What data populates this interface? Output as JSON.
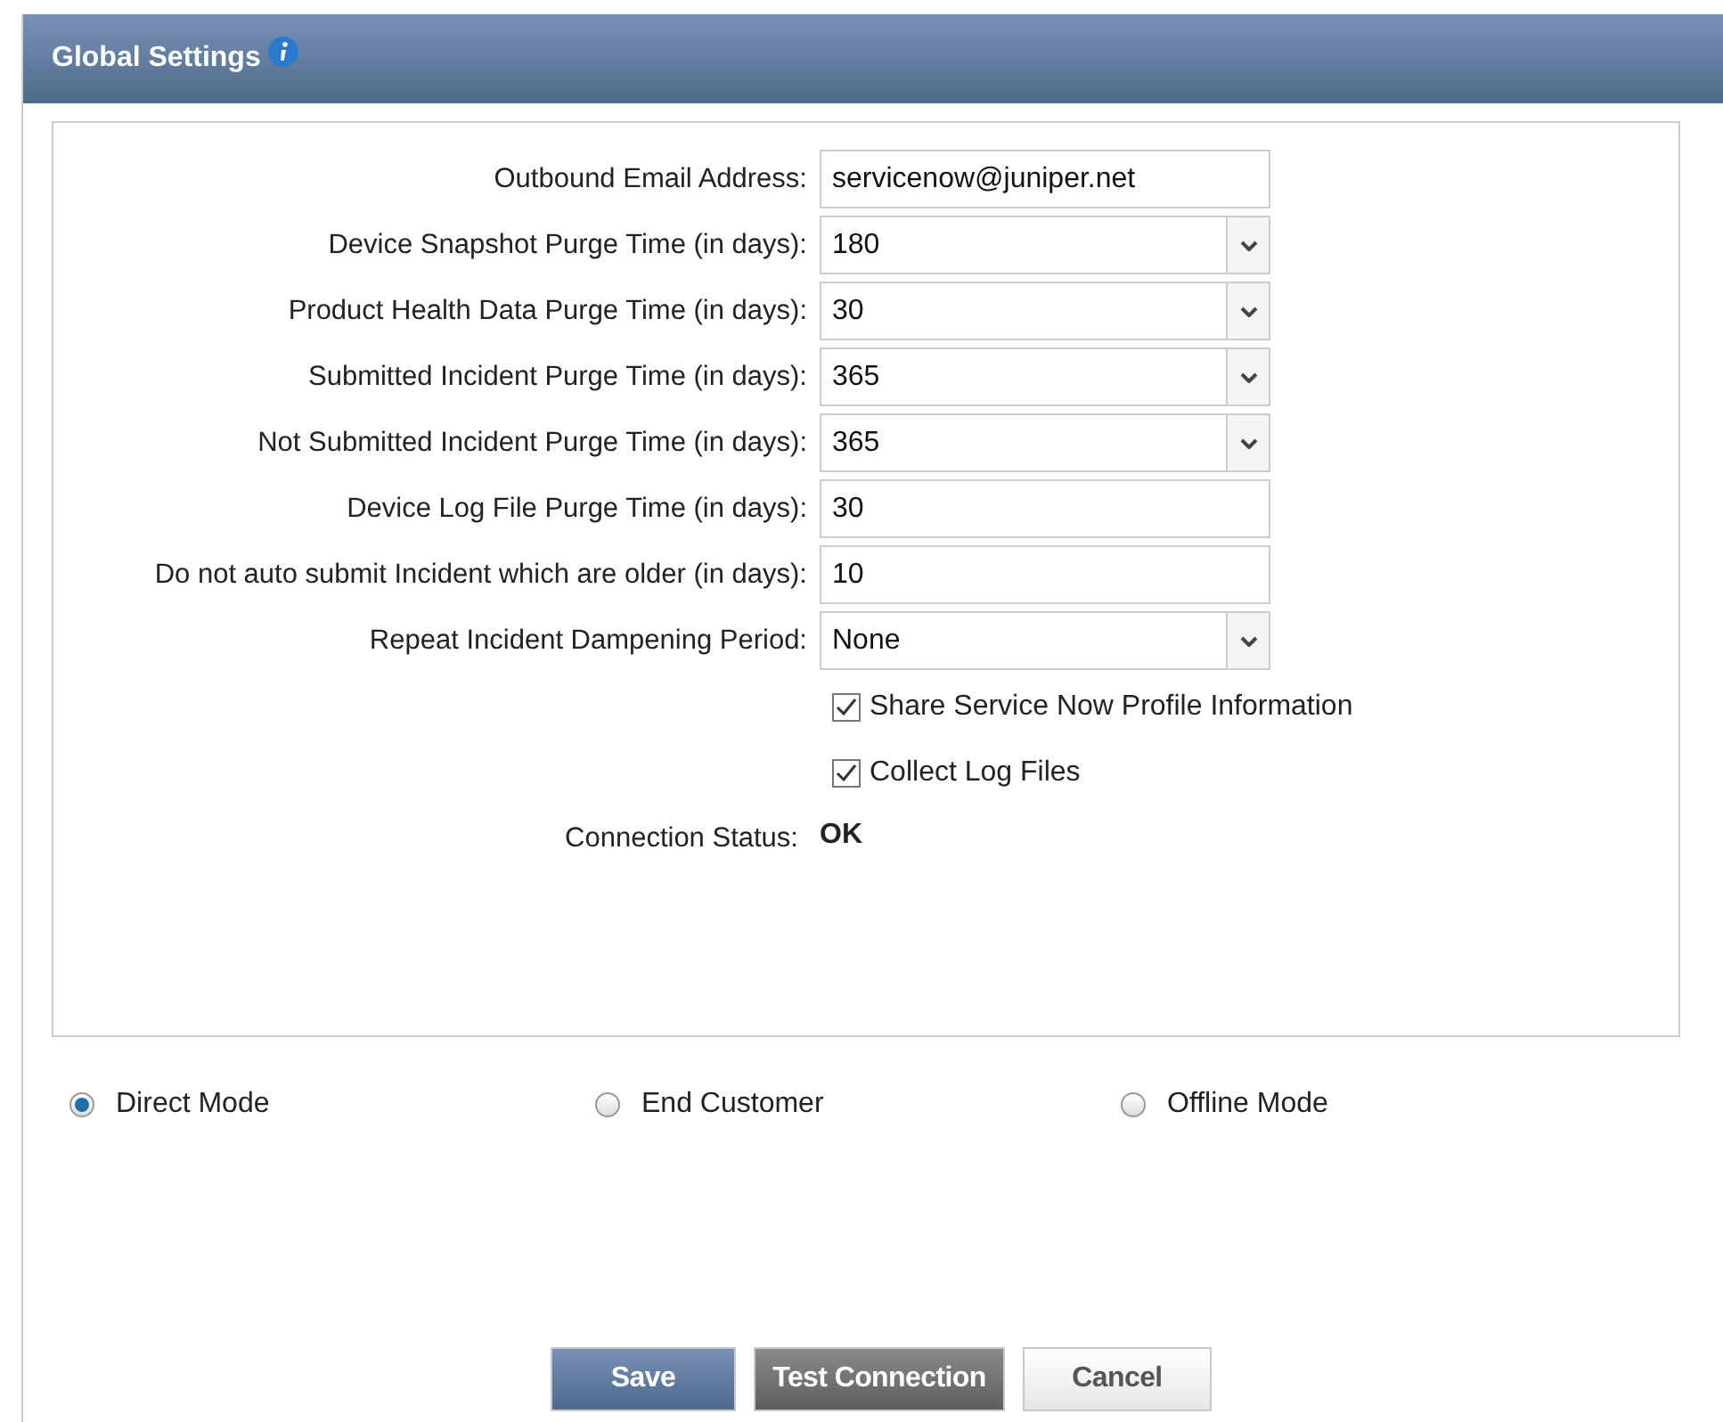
{
  "panel": {
    "title": "Global Settings"
  },
  "fields": [
    {
      "label": "Outbound Email Address:",
      "kind": "text",
      "value": "servicenow@juniper.net"
    },
    {
      "label": "Device Snapshot Purge Time (in days):",
      "kind": "select",
      "value": "180"
    },
    {
      "label": "Product Health Data Purge Time (in days):",
      "kind": "select",
      "value": "30"
    },
    {
      "label": "Submitted Incident Purge Time (in days):",
      "kind": "select",
      "value": "365"
    },
    {
      "label": "Not Submitted Incident Purge Time (in days):",
      "kind": "select",
      "value": "365"
    },
    {
      "label": "Device Log File Purge Time (in days):",
      "kind": "text",
      "value": "30"
    },
    {
      "label": "Do not auto submit Incident which are older (in days):",
      "kind": "text",
      "value": "10"
    },
    {
      "label": "Repeat Incident Dampening Period:",
      "kind": "select",
      "value": "None"
    }
  ],
  "checkboxes": [
    {
      "label": "Share Service Now Profile Information",
      "checked": true
    },
    {
      "label": "Collect Log Files",
      "checked": true
    }
  ],
  "status": {
    "label": "Connection Status:",
    "value": "OK"
  },
  "modes": [
    {
      "label": "Direct Mode",
      "selected": true
    },
    {
      "label": "End Customer",
      "selected": false
    },
    {
      "label": "Offline Mode",
      "selected": false
    }
  ],
  "buttons": [
    {
      "label": "Save",
      "kind": "primary"
    },
    {
      "label": "Test Connection",
      "kind": "dark"
    },
    {
      "label": "Cancel",
      "kind": "default"
    }
  ]
}
